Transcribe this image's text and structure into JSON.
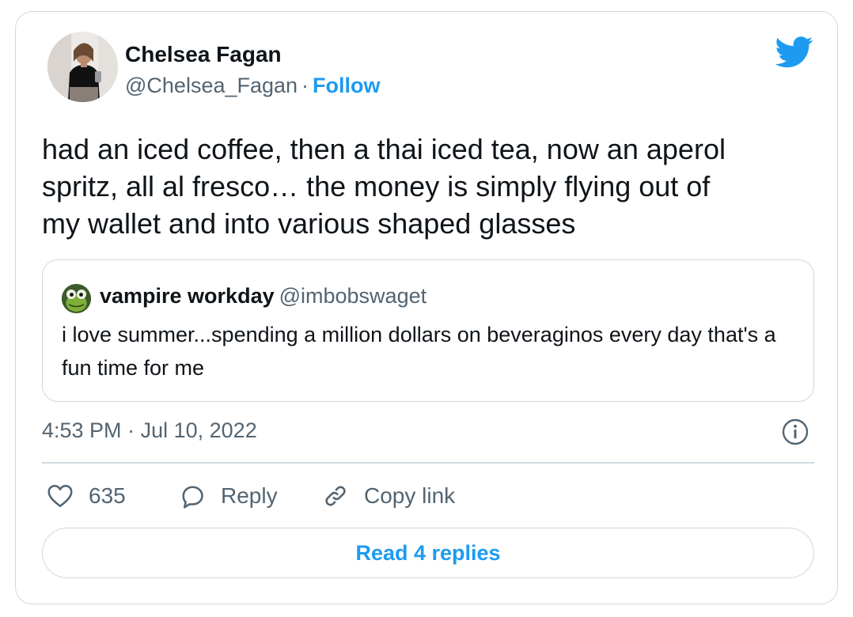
{
  "author": {
    "name": "Chelsea Fagan",
    "handle": "@Chelsea_Fagan",
    "separator": "·",
    "follow_label": "Follow"
  },
  "tweet": {
    "text": "had an iced coffee, then a thai iced tea, now an aperol\nspritz, all al fresco… the money is simply flying out of\nmy wallet and into various shaped glasses",
    "time": "4:53 PM",
    "time_separator": "·",
    "date": "Jul 10, 2022"
  },
  "quoted_tweet": {
    "name": "vampire workday",
    "handle": "@imbobswaget",
    "text": "i love summer...spending a million dollars on beveraginos every day that's a fun time for me"
  },
  "actions": {
    "like_icon": "heart-icon",
    "like_count": "635",
    "reply_icon": "speech-bubble-icon",
    "reply_label": "Reply",
    "copy_icon": "link-icon",
    "copy_label": "Copy link"
  },
  "footer": {
    "read_replies_label": "Read 4 replies"
  },
  "icons": {
    "brand": "twitter-bird-icon",
    "info": "info-icon"
  },
  "colors": {
    "accent": "#1d9bf0",
    "text": "#0f1419",
    "secondary_text": "#536471",
    "border": "#cfd9de"
  }
}
